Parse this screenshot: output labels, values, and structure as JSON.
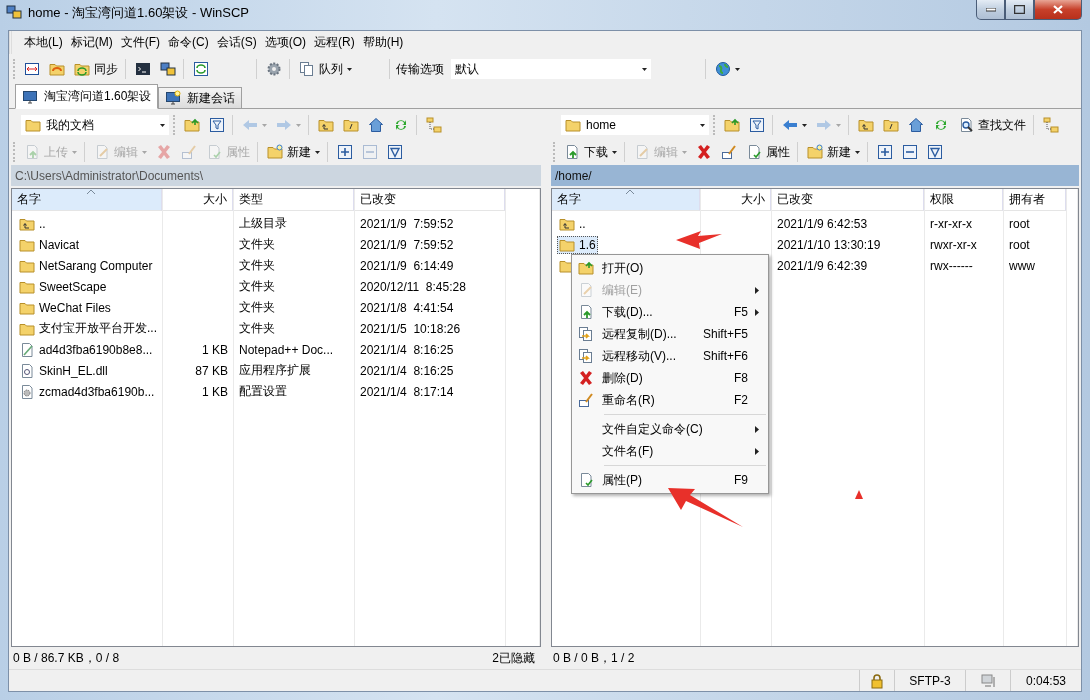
{
  "window": {
    "title": "home - 淘宝湾问道1.60架设 - WinSCP"
  },
  "menu": [
    "本地(L)",
    "标记(M)",
    "文件(F)",
    "命令(C)",
    "会话(S)",
    "选项(O)",
    "远程(R)",
    "帮助(H)"
  ],
  "toolbar": [
    {
      "items": [
        {
          "kind": "icon"
        },
        {
          "kind": "icon"
        },
        {
          "kind": "button",
          "label": "同步"
        }
      ]
    },
    {
      "items": [
        {
          "kind": "icon"
        },
        {
          "kind": "icon"
        }
      ]
    },
    {
      "items": [
        {
          "kind": "icon"
        }
      ]
    },
    {
      "items": [
        {
          "kind": "icon"
        }
      ]
    },
    {
      "items": [
        {
          "kind": "button",
          "label": "队列",
          "menu": true
        }
      ]
    },
    {
      "items": [
        {
          "kind": "combo",
          "label": "传输选项",
          "value": "默认"
        }
      ]
    },
    {
      "items": [
        {
          "kind": "icon",
          "menu": true
        }
      ]
    }
  ],
  "tabs": [
    {
      "label": "淘宝湾问道1.60架设",
      "selected": true
    },
    {
      "label": "新建会话",
      "selected": false
    }
  ],
  "left_pane": {
    "active": false,
    "location": "我的文档",
    "toolbar1": [
      {
        "items": [
          {
            "kind": "icon",
            "disabled": false
          },
          {
            "kind": "icon",
            "disabled": false
          }
        ]
      },
      {
        "items": [
          {
            "kind": "icon",
            "menu": true,
            "disabled": true
          },
          {
            "kind": "icon",
            "menu": true,
            "disabled": true
          }
        ]
      },
      {
        "items": [
          {
            "kind": "icon",
            "disabled": false
          },
          {
            "kind": "icon",
            "disabled": false
          },
          {
            "kind": "icon",
            "disabled": false
          },
          {
            "kind": "icon",
            "disabled": false
          }
        ]
      },
      {
        "items": [
          {
            "kind": "icon",
            "disabled": false
          }
        ]
      }
    ],
    "toolbar2": [
      {
        "items": [
          {
            "kind": "button",
            "label": "上传",
            "menu": true,
            "disabled": true
          }
        ]
      },
      {
        "items": [
          {
            "kind": "button",
            "label": "编辑",
            "menu": true,
            "disabled": true
          },
          {
            "kind": "icon",
            "disabled": true
          },
          {
            "kind": "icon",
            "disabled": true
          },
          {
            "kind": "button",
            "label": "属性",
            "disabled": true
          }
        ]
      },
      {
        "items": [
          {
            "kind": "button",
            "label": "新建",
            "menu": true,
            "disabled": false
          }
        ]
      },
      {
        "items": [
          {
            "kind": "icon",
            "disabled": false
          },
          {
            "kind": "icon",
            "disabled": true
          },
          {
            "kind": "icon",
            "disabled": false
          }
        ]
      }
    ],
    "path": "C:\\Users\\Administrator\\Documents\\",
    "columns": [
      {
        "label": "名字",
        "sorted": true
      },
      {
        "label": "大小",
        "sorted": false
      },
      {
        "label": "类型",
        "sorted": false
      },
      {
        "label": "已改变",
        "sorted": false
      }
    ],
    "rows": [
      {
        "kind": "parent",
        "name": "..",
        "type": "上级目录",
        "changed": "2021/1/9  7:59:52",
        "selected": false
      },
      {
        "kind": "folder",
        "name": "Navicat",
        "type": "文件夹",
        "changed": "2021/1/9  7:59:52",
        "selected": false
      },
      {
        "kind": "folder",
        "name": "NetSarang Computer",
        "type": "文件夹",
        "changed": "2021/1/9  6:14:49",
        "selected": false
      },
      {
        "kind": "folder",
        "name": "SweetScape",
        "type": "文件夹",
        "changed": "2020/12/11  8:45:28",
        "selected": false
      },
      {
        "kind": "folder",
        "name": "WeChat Files",
        "type": "文件夹",
        "changed": "2021/1/8  4:41:54",
        "selected": false
      },
      {
        "kind": "folder",
        "name": "支付宝开放平台开发...",
        "type": "文件夹",
        "changed": "2021/1/5  10:18:26",
        "selected": false
      },
      {
        "kind": "notepad",
        "name": "ad4d3fba6190b8e8...",
        "size": "1 KB",
        "type": "Notepad++ Doc...",
        "changed": "2021/1/4  8:16:25",
        "selected": false
      },
      {
        "kind": "dll",
        "name": "SkinH_EL.dll",
        "size": "87 KB",
        "type": "应用程序扩展",
        "changed": "2021/1/4  8:16:25",
        "selected": false
      },
      {
        "kind": "config",
        "name": "zcmad4d3fba6190b...",
        "size": "1 KB",
        "type": "配置设置",
        "changed": "2021/1/4  8:17:14",
        "selected": false
      }
    ],
    "status": "0 B / 86.7 KB，0 / 8",
    "status_right": "2已隐藏"
  },
  "right_pane": {
    "active": true,
    "location": "home",
    "toolbar1": [
      {
        "items": [
          {
            "kind": "icon",
            "disabled": false
          },
          {
            "kind": "icon",
            "disabled": false
          }
        ]
      },
      {
        "items": [
          {
            "kind": "icon",
            "menu": true,
            "disabled": false
          },
          {
            "kind": "icon",
            "menu": true,
            "disabled": true
          }
        ]
      },
      {
        "items": [
          {
            "kind": "icon",
            "disabled": false
          },
          {
            "kind": "icon",
            "disabled": false
          },
          {
            "kind": "icon",
            "disabled": false
          },
          {
            "kind": "icon",
            "disabled": false
          },
          {
            "kind": "button",
            "label": "查找文件",
            "disabled": false
          }
        ]
      },
      {
        "items": [
          {
            "kind": "icon",
            "disabled": false
          }
        ]
      }
    ],
    "toolbar2": [
      {
        "items": [
          {
            "kind": "button",
            "label": "下载",
            "menu": true,
            "disabled": false
          }
        ]
      },
      {
        "items": [
          {
            "kind": "button",
            "label": "编辑",
            "menu": true,
            "disabled": true
          },
          {
            "kind": "icon",
            "disabled": false
          },
          {
            "kind": "icon",
            "disabled": false
          },
          {
            "kind": "button",
            "label": "属性",
            "disabled": false
          }
        ]
      },
      {
        "items": [
          {
            "kind": "button",
            "label": "新建",
            "menu": true,
            "disabled": false
          }
        ]
      },
      {
        "items": [
          {
            "kind": "icon",
            "disabled": false
          },
          {
            "kind": "icon",
            "disabled": false
          },
          {
            "kind": "icon",
            "disabled": false
          }
        ]
      }
    ],
    "path": "/home/",
    "columns": [
      {
        "label": "名字",
        "sorted": true
      },
      {
        "label": "大小",
        "sorted": false
      },
      {
        "label": "已改变",
        "sorted": false
      },
      {
        "label": "权限",
        "sorted": false
      },
      {
        "label": "拥有者",
        "sorted": false
      }
    ],
    "rows": [
      {
        "kind": "parent",
        "name": "..",
        "changed": "2021/1/9 6:42:53",
        "rights": "r-xr-xr-x",
        "owner": "root",
        "selected": false
      },
      {
        "kind": "folder",
        "name": "1.6",
        "changed": "2021/1/10 13:30:19",
        "rights": "rwxr-xr-x",
        "owner": "root",
        "selected": true
      },
      {
        "kind": "folder",
        "changed": "2021/1/9 6:42:39",
        "rights": "rwx------",
        "owner": "www",
        "selected": false
      }
    ],
    "status": "0 B / 0 B，1 / 2"
  },
  "context_menu": [
    {
      "kind": "item",
      "label": "打开(O)",
      "disabled": false
    },
    {
      "kind": "item",
      "label": "编辑(E)",
      "disabled": true,
      "submenu": true
    },
    {
      "kind": "item",
      "label": "下载(D)...",
      "shortcut": "F5",
      "disabled": false,
      "submenu": true
    },
    {
      "kind": "item",
      "label": "远程复制(D)...",
      "shortcut": "Shift+F5",
      "disabled": false
    },
    {
      "kind": "item",
      "label": "远程移动(V)...",
      "shortcut": "Shift+F6",
      "disabled": false
    },
    {
      "kind": "item",
      "label": "删除(D)",
      "shortcut": "F8",
      "disabled": false
    },
    {
      "kind": "item",
      "label": "重命名(R)",
      "shortcut": "F2",
      "disabled": false
    },
    {
      "kind": "separator"
    },
    {
      "kind": "item",
      "label": "文件自定义命令(C)",
      "disabled": false,
      "submenu": true
    },
    {
      "kind": "item",
      "label": "文件名(F)",
      "disabled": false,
      "submenu": true
    },
    {
      "kind": "separator"
    },
    {
      "kind": "item",
      "label": "属性(P)",
      "shortcut": "F9",
      "disabled": false
    }
  ],
  "status_bar": {
    "protocol": "SFTP-3",
    "elapsed": "0:04:53"
  }
}
